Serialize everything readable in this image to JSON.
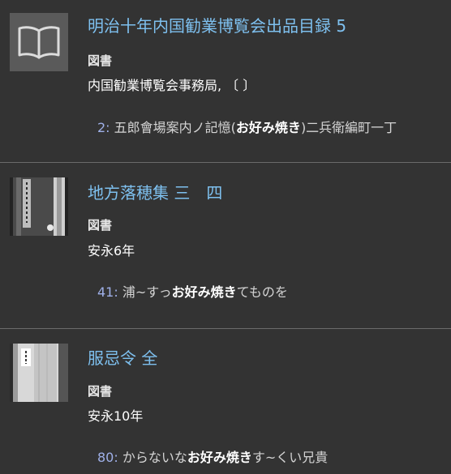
{
  "results": [
    {
      "title": "明治十年内国勧業博覧会出品目録 5",
      "thumbnail_icon": "open-book-icon",
      "type_label": "図書",
      "meta": "内国勧業博覧会事務局, 〔 〕",
      "snippet": {
        "line_no": "2:",
        "before": " 五郎會場案内ノ記憶(",
        "highlight": "お好み焼き",
        "after": ")二兵衛編町一丁"
      }
    },
    {
      "title": "地方落穂集 三　四",
      "thumbnail_icon": "manuscript-scan",
      "type_label": "図書",
      "meta": "安永6年",
      "snippet": {
        "line_no": "41:",
        "before": " 浦~すっ",
        "highlight": "お好み焼き",
        "after": "てものを"
      }
    },
    {
      "title": "服忌令 全",
      "thumbnail_icon": "manuscript-scan",
      "type_label": "図書",
      "meta": "安永10年",
      "snippet": {
        "line_no": "80:",
        "before": " からないな",
        "highlight": "お好み焼き",
        "after": "す~くい兄貴"
      }
    }
  ]
}
